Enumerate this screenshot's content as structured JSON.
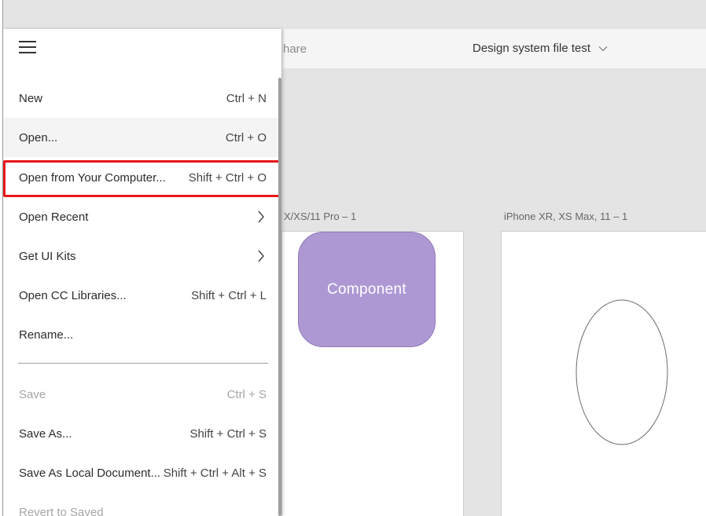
{
  "toolbar": {
    "share_label": "hare",
    "document_title": "Design system file test"
  },
  "canvas": {
    "artboard_left_label": "X/XS/11 Pro – 1",
    "artboard_right_label": "iPhone XR, XS Max, 11 – 1",
    "component_label": "Component"
  },
  "menu": {
    "items": [
      {
        "label": "New",
        "shortcut": "Ctrl + N"
      },
      {
        "label": "Open...",
        "shortcut": "Ctrl + O"
      },
      {
        "label": "Open from Your Computer...",
        "shortcut": "Shift + Ctrl + O"
      },
      {
        "label": "Open Recent",
        "shortcut": ""
      },
      {
        "label": "Get UI Kits",
        "shortcut": ""
      },
      {
        "label": "Open CC Libraries...",
        "shortcut": "Shift + Ctrl + L"
      },
      {
        "label": "Rename...",
        "shortcut": ""
      },
      {
        "label": "Save",
        "shortcut": "Ctrl + S"
      },
      {
        "label": "Save As...",
        "shortcut": "Shift + Ctrl + S"
      },
      {
        "label": "Save As Local Document...",
        "shortcut": "Shift + Ctrl + Alt + S"
      },
      {
        "label": "Revert to Saved",
        "shortcut": ""
      }
    ]
  },
  "colors": {
    "highlight": "#e8161b",
    "component_fill": "#ad98d4"
  }
}
